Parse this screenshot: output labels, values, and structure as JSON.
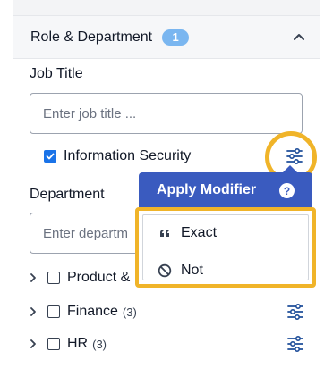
{
  "section": {
    "title": "Role & Department",
    "badge": "1"
  },
  "job_title": {
    "label": "Job Title",
    "placeholder": "Enter job title ...",
    "checked_item": "Information Security"
  },
  "department": {
    "label": "Department",
    "placeholder": "Enter departm",
    "items": [
      {
        "label": "Product &",
        "count": ""
      },
      {
        "label": "Finance",
        "count": "(3)"
      },
      {
        "label": "HR",
        "count": "(3)"
      }
    ]
  },
  "modifier_popup": {
    "title": "Apply Modifier",
    "help": "?",
    "options": [
      "Exact",
      "Not"
    ]
  },
  "colors": {
    "accent": "#1a73e8",
    "popup_header": "#3a5bbf",
    "highlight": "#f0b429",
    "badge": "#7ab6f0"
  }
}
